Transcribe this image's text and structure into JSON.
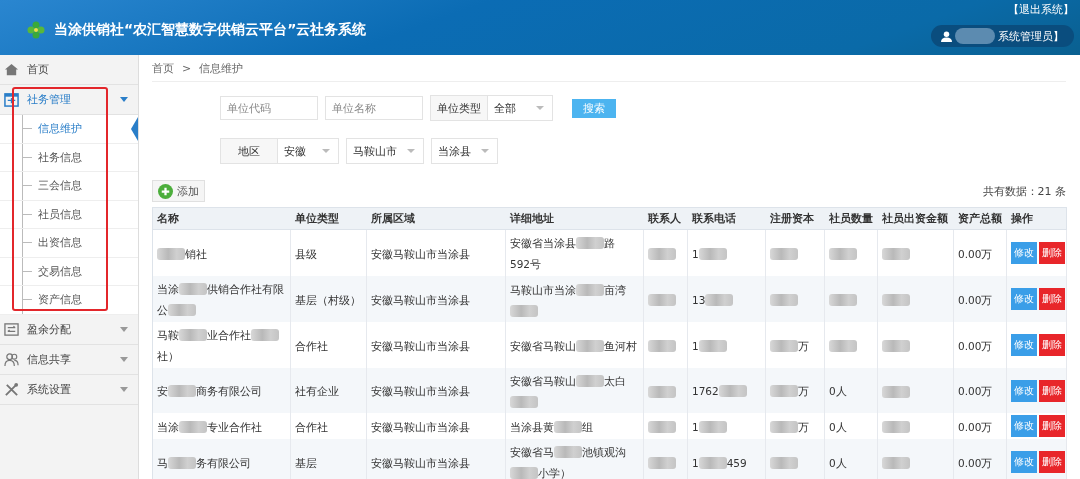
{
  "header": {
    "title": "当涂供销社“农汇智慧数字供销云平台”云社务系统",
    "logout": "【退出系统】",
    "user": [
      {
        "kind": "blur"
      },
      "系统管理员】"
    ]
  },
  "sidebar": {
    "items": [
      {
        "label": "首页",
        "selected": false
      },
      {
        "label": "社务管理",
        "selected": true,
        "expanded": true,
        "children": [
          {
            "label": "信息维护",
            "selected": true
          },
          {
            "label": "社务信息",
            "selected": false
          },
          {
            "label": "三会信息",
            "selected": false
          },
          {
            "label": "社员信息",
            "selected": false
          },
          {
            "label": "出资信息",
            "selected": false
          },
          {
            "label": "交易信息",
            "selected": false
          },
          {
            "label": "资产信息",
            "selected": false
          }
        ]
      },
      {
        "label": "盈余分配",
        "selected": false,
        "expanded": false
      },
      {
        "label": "信息共享",
        "selected": false,
        "expanded": false
      },
      {
        "label": "系统设置",
        "selected": false,
        "expanded": false
      }
    ]
  },
  "annotation": {
    "kind": "rectangle",
    "color": "#e3262b"
  },
  "breadcrumb": [
    "首页",
    ">",
    "信息维护"
  ],
  "filters": {
    "code": {
      "placeholder": "单位代码"
    },
    "name": {
      "placeholder": "单位名称"
    },
    "type": {
      "label": "单位类型",
      "value": "全部"
    },
    "search": "搜索",
    "region": {
      "label": "地区",
      "values": [
        "安徽",
        "马鞍山市",
        "当涂县"
      ]
    }
  },
  "add_button": "添加",
  "total": "共有数据：21 条",
  "table": {
    "columns": [
      "名称",
      "单位类型",
      "所属区域",
      "详细地址",
      "联系人",
      "联系电话",
      "注册资本",
      "社员数量",
      "社员出资金额",
      "资产总额",
      "操作"
    ],
    "rows": [
      {
        "cells": [
          [
            {
              "kind": "blur"
            },
            "销社"
          ],
          "县级",
          "安徽马鞍山市当涂县",
          [
            "安徽省当涂县",
            {
              "kind": "blur"
            },
            "路",
            "592号"
          ],
          [
            {
              "kind": "blur"
            }
          ],
          [
            "1",
            {
              "kind": "blur"
            }
          ],
          [
            {
              "kind": "blur"
            }
          ],
          [
            {
              "kind": "blur"
            }
          ],
          [
            {
              "kind": "blur"
            }
          ],
          "0.00万"
        ],
        "actions": [
          "修改",
          "删除"
        ]
      },
      {
        "cells": [
          [
            "当涂",
            {
              "kind": "blur"
            },
            "供销合作社有限",
            "公",
            {
              "kind": "blur"
            }
          ],
          "基层（村级）",
          "安徽马鞍山市当涂县",
          [
            "马鞍山市当涂",
            {
              "kind": "blur"
            },
            "亩",
            "湾",
            {
              "kind": "blur"
            }
          ],
          [
            {
              "kind": "blur"
            }
          ],
          [
            "13",
            {
              "kind": "blur"
            }
          ],
          [
            {
              "kind": "blur"
            }
          ],
          [
            {
              "kind": "blur"
            }
          ],
          [
            {
              "kind": "blur"
            }
          ],
          "0.00万"
        ],
        "actions": [
          "修改",
          "删除"
        ]
      },
      {
        "cells": [
          [
            "马鞍",
            {
              "kind": "blur"
            },
            "业合作社",
            {
              "kind": "blur"
            },
            "社）"
          ],
          "合作社",
          "安徽马鞍山市当涂县",
          [
            "安徽省马鞍山",
            {
              "kind": "blur"
            },
            "鱼",
            "河村"
          ],
          [
            {
              "kind": "blur"
            }
          ],
          [
            "1",
            {
              "kind": "blur"
            }
          ],
          [
            {
              "kind": "blur"
            },
            "万"
          ],
          [
            {
              "kind": "blur"
            }
          ],
          [
            {
              "kind": "blur"
            }
          ],
          "0.00万"
        ],
        "actions": [
          "修改",
          "删除"
        ]
      },
      {
        "cells": [
          [
            "安",
            {
              "kind": "blur"
            },
            "商务有限公司"
          ],
          "社有企业",
          "安徽马鞍山市当涂县",
          [
            "安徽省马鞍山",
            {
              "kind": "blur"
            },
            "太",
            "白",
            {
              "kind": "blur"
            }
          ],
          [
            {
              "kind": "blur"
            }
          ],
          [
            "1762",
            {
              "kind": "blur"
            }
          ],
          [
            {
              "kind": "blur"
            },
            "万"
          ],
          "0人",
          [
            {
              "kind": "blur"
            }
          ],
          "0.00万"
        ],
        "actions": [
          "修改",
          "删除"
        ]
      },
      {
        "cells": [
          [
            "当涂",
            {
              "kind": "blur"
            },
            "专业合作社"
          ],
          "合作社",
          "安徽马鞍山市当涂县",
          [
            "当涂县黄",
            {
              "kind": "blur"
            },
            "组"
          ],
          [
            {
              "kind": "blur"
            }
          ],
          [
            "1",
            {
              "kind": "blur"
            }
          ],
          [
            {
              "kind": "blur"
            },
            "万"
          ],
          "0人",
          [
            {
              "kind": "blur"
            }
          ],
          "0.00万"
        ],
        "actions": [
          "修改",
          "删除"
        ]
      },
      {
        "cells": [
          [
            "马",
            {
              "kind": "blur"
            },
            "务有限公",
            "司"
          ],
          "基层",
          "安徽马鞍山市当涂县",
          [
            "安徽省马",
            {
              "kind": "blur"
            },
            "池镇观",
            "沟",
            {
              "kind": "blur"
            },
            "小学）"
          ],
          [
            {
              "kind": "blur"
            }
          ],
          [
            "1",
            {
              "kind": "blur"
            },
            "459"
          ],
          [
            {
              "kind": "blur"
            }
          ],
          "0人",
          [
            {
              "kind": "blur"
            }
          ],
          "0.00万"
        ],
        "actions": [
          "修改",
          "删除"
        ]
      }
    ]
  }
}
